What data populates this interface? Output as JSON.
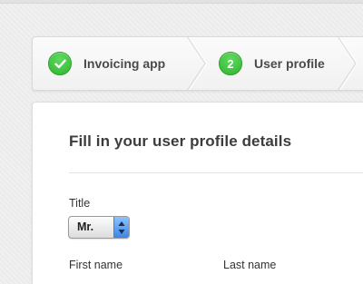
{
  "stepper": {
    "steps": [
      {
        "label": "Invoicing app",
        "state": "completed",
        "icon": "check-icon"
      },
      {
        "label": "User profile",
        "state": "current",
        "number": "2"
      }
    ]
  },
  "form": {
    "heading": "Fill in your user profile details",
    "title_field": {
      "label": "Title",
      "value": "Mr."
    },
    "first_name_label": "First name",
    "last_name_label": "Last name"
  },
  "colors": {
    "badge_green": "#3cc43c",
    "select_accent": "#4a90e8",
    "text": "#4a4a4a"
  }
}
